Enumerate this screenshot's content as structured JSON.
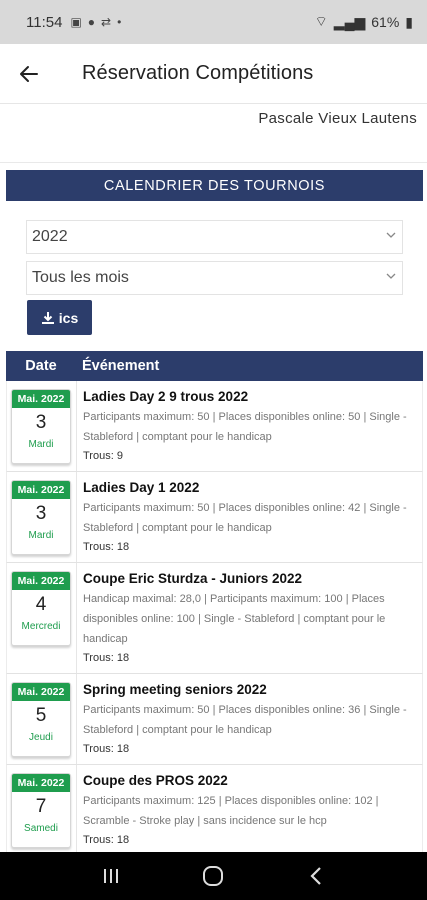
{
  "status": {
    "time": "11:54",
    "battery": "61%"
  },
  "app": {
    "title": "Réservation Compétitions",
    "user": "Pascale Vieux Lautens"
  },
  "section_title": "CALENDRIER DES TOURNOIS",
  "filters": {
    "year": "2022",
    "month": "Tous les mois",
    "ics_label": "ics"
  },
  "table": {
    "col_date": "Date",
    "col_event": "Événement",
    "rows": [
      {
        "month": "Mai. 2022",
        "day": "3",
        "weekday": "Mardi",
        "title": "Ladies Day 2 9 trous 2022",
        "desc": "Participants maximum: 50 | Places disponibles online:  50 | Single - Stableford | comptant pour le handicap",
        "trous": "Trous: 9"
      },
      {
        "month": "Mai. 2022",
        "day": "3",
        "weekday": "Mardi",
        "title": "Ladies Day 1 2022",
        "desc": "Participants maximum: 50 | Places disponibles online:  42 | Single - Stableford | comptant pour le handicap",
        "trous": "Trous: 18"
      },
      {
        "month": "Mai. 2022",
        "day": "4",
        "weekday": "Mercredi",
        "title": "Coupe Eric Sturdza - Juniors 2022",
        "desc": "Handicap maximal: 28,0 | Participants maximum: 100 | Places disponibles online:  100 | Single - Stableford | comptant pour le handicap",
        "trous": "Trous: 18"
      },
      {
        "month": "Mai. 2022",
        "day": "5",
        "weekday": "Jeudi",
        "title": "Spring meeting seniors 2022",
        "desc": "Participants maximum: 50 | Places disponibles online:  36 | Single - Stableford | comptant pour le handicap",
        "trous": "Trous: 18"
      },
      {
        "month": "Mai. 2022",
        "day": "7",
        "weekday": "Samedi",
        "title": "Coupe des PROS 2022",
        "desc": "Participants maximum: 125 | Places disponibles online:  102 | Scramble - Stroke play | sans incidence sur le hcp",
        "trous": "Trous: 18"
      }
    ]
  },
  "colors": {
    "navy": "#2c3d6b",
    "green": "#1f9d4e",
    "status_bar": "#d9d9d9"
  }
}
